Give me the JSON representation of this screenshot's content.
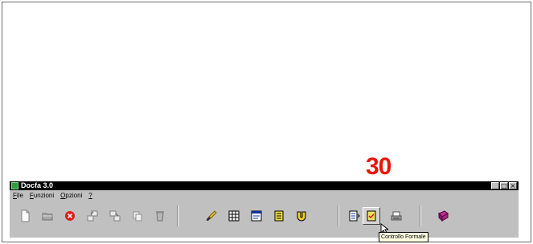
{
  "step_number": "30",
  "colors": {
    "step_number": "#e8160c",
    "title_bar": "#000000",
    "window_bg": "#c0c0c0",
    "tooltip_bg": "#ffffe1"
  },
  "window": {
    "title": "Docfa 3.0",
    "buttons": [
      "minimize",
      "maximize",
      "close"
    ]
  },
  "menu": [
    {
      "accel": "F",
      "rest": "ile"
    },
    {
      "accel": "F",
      "rest": "unzioni"
    },
    {
      "accel": "O",
      "rest": "pzioni"
    },
    {
      "accel": "?",
      "rest": ""
    }
  ],
  "toolbar": {
    "icons": [
      "new-document-icon",
      "open-folder-icon",
      "delete-icon",
      "export-icon",
      "import-icon",
      "copy-icon",
      "recycle-icon",
      "brush-icon",
      "grid-icon",
      "form-icon",
      "list-icon",
      "magnet-icon",
      "arrow-list-icon",
      "formal-check-icon",
      "printer-icon",
      "book-icon"
    ],
    "pressed": "formal-check-icon"
  },
  "tooltip": {
    "text": "Controllo Formale"
  }
}
